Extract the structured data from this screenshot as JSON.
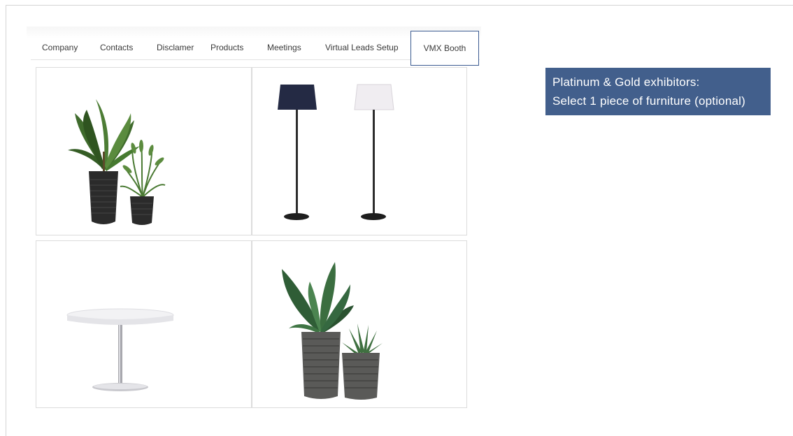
{
  "tabs": [
    {
      "label": "Company"
    },
    {
      "label": "Contacts"
    },
    {
      "label": "Disclamer"
    },
    {
      "label": "Products"
    },
    {
      "label": "Meetings"
    },
    {
      "label": "Virtual Leads Setup"
    },
    {
      "label": "VMX Booth",
      "active": true
    }
  ],
  "callout": {
    "line1": "Platinum & Gold exhibitors:",
    "line2": "Select 1 piece of furniture (optional)"
  },
  "furniture": [
    {
      "item": "two potted plants (banana plant and palm) in dark ribbed pots",
      "icon": "potted-plants-icon"
    },
    {
      "item": "two floor lamps with navy and white shades",
      "icon": "floor-lamps-icon"
    },
    {
      "item": "round white pedestal table",
      "icon": "round-table-icon"
    },
    {
      "item": "two potted plants (large-leaf and aloe) in grey striped pots",
      "icon": "potted-plants-icon"
    }
  ],
  "colors": {
    "callout_bg": "#425f8c",
    "active_tab_border": "#3a5a90"
  }
}
